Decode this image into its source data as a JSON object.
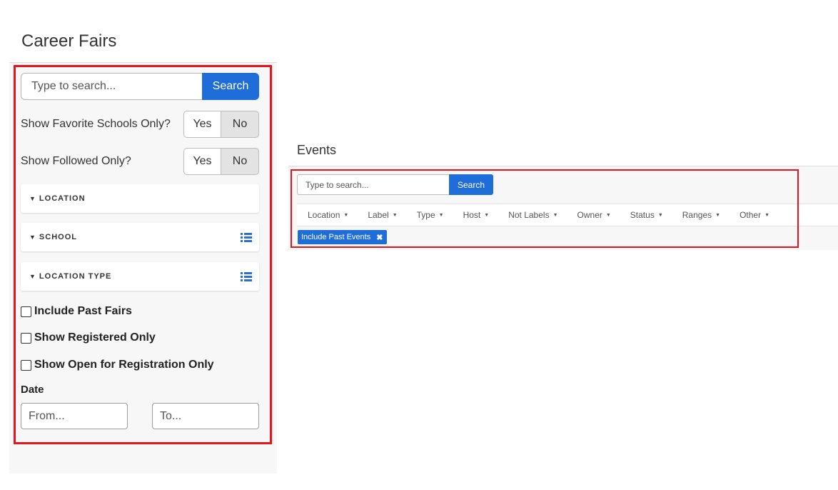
{
  "career_fairs": {
    "title": "Career Fairs",
    "search": {
      "placeholder": "Type to search...",
      "button_label": "Search"
    },
    "toggles": [
      {
        "label": "Show Favorite Schools Only?",
        "yes": "Yes",
        "no": "No",
        "selected": "No"
      },
      {
        "label": "Show Followed Only?",
        "yes": "Yes",
        "no": "No",
        "selected": "No"
      }
    ],
    "filter_sections": [
      {
        "label": "LOCATION",
        "icon": "caret-down-icon"
      },
      {
        "label": "SCHOOL",
        "icon": "caret-down-icon",
        "action_icon": "list-icon"
      },
      {
        "label": "LOCATION TYPE",
        "icon": "caret-down-icon",
        "action_icon": "list-icon"
      }
    ],
    "checkboxes": [
      {
        "label": "Include Past Fairs",
        "checked": false
      },
      {
        "label": "Show Registered Only",
        "checked": false
      },
      {
        "label": "Show Open for Registration Only",
        "checked": false
      }
    ],
    "date": {
      "label": "Date",
      "from_placeholder": "From...",
      "to_placeholder": "To..."
    }
  },
  "events": {
    "title": "Events",
    "search": {
      "placeholder": "Type to search...",
      "button_label": "Search"
    },
    "filters": [
      "Location",
      "Label",
      "Type",
      "Host",
      "Not Labels",
      "Owner",
      "Status",
      "Ranges",
      "Other"
    ],
    "active_tags": [
      {
        "label": "Include Past Events",
        "remove_icon": "close-icon"
      }
    ]
  },
  "colors": {
    "accent": "#1f6dd9",
    "highlight": "#e8141b",
    "panel_bg": "#f7f7f7"
  }
}
